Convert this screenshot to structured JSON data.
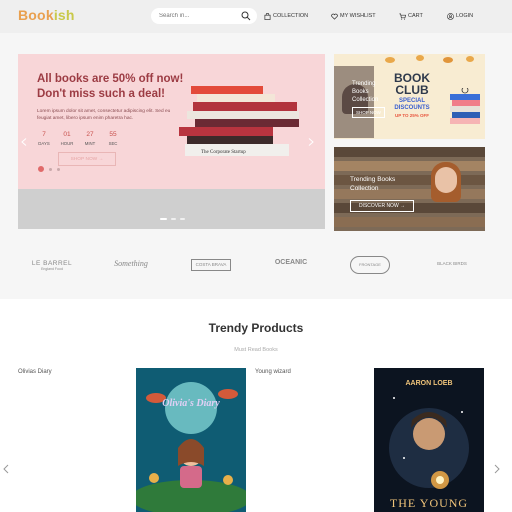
{
  "header": {
    "logo": {
      "part1": "Book",
      "part2": "ish"
    },
    "search_placeholder": "Search in...",
    "nav": {
      "collection": "COLLECTION",
      "wishlist": "MY WISHLIST",
      "cart": "CART",
      "login": "LOGIN"
    }
  },
  "hero": {
    "title": "All books are 50% off now! Don't miss such a deal!",
    "description": "Lorem ipsum dolor sit amet, consectetur adipiscing elit. Sed eu feugiat amet, libero ipsum enim pharetra hac.",
    "countdown": [
      {
        "value": "7",
        "label": "DAYS"
      },
      {
        "value": "01",
        "label": "HOUR"
      },
      {
        "value": "27",
        "label": "MINT"
      },
      {
        "value": "55",
        "label": "SEC"
      }
    ],
    "button": "SHOP NOW →",
    "book_spine_text": "The Corporate Startup"
  },
  "book_club": {
    "title_line1": "BOOK",
    "title_line2": "CLUB",
    "special": "SPECIAL",
    "discounts": "DISCOUNTS",
    "off": "UP TO 25% OFF",
    "overlay_title": "Trending Books Collection",
    "overlay_btn": "SHOP NOW"
  },
  "trending": {
    "title": "Trending Books Collection",
    "button": "DISCOVER NOW →"
  },
  "brands": [
    {
      "name": "LE BARREL",
      "sub": "England Food"
    },
    {
      "name": "Something"
    },
    {
      "name": "COSTA BRAVA"
    },
    {
      "name": "OCEANIC"
    },
    {
      "name": "FRONTAGE"
    },
    {
      "name": "BLACK BIRDS"
    }
  ],
  "trendy": {
    "title": "Trendy Products",
    "subtitle": "Must Read Books",
    "products": [
      {
        "label": "Olivias Diary",
        "cover_title": "Olivia's Diary"
      },
      {
        "label": "Young wizard",
        "cover_author": "AARON LOEB",
        "cover_title": "THE YOUNG"
      }
    ]
  },
  "colors": {
    "header_bg": "#efefef",
    "hero_pink": "#f8d6d8",
    "hero_title": "#9c3b43",
    "accent_orange": "#e9a04f"
  }
}
